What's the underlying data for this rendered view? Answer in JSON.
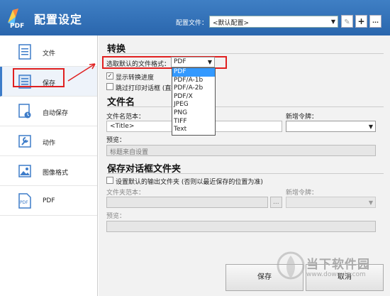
{
  "titlebar": {
    "app_title": "配置设定",
    "logo_text": "PDF",
    "config_label": "配置文件：",
    "config_value": "<默认配置>",
    "add_label": "+",
    "more_label": "···"
  },
  "sidebar": {
    "items": [
      {
        "label": "文件",
        "icon": "document-icon"
      },
      {
        "label": "保存",
        "icon": "save-icon"
      },
      {
        "label": "自动保存",
        "icon": "autosave-icon"
      },
      {
        "label": "动作",
        "icon": "wrench-icon"
      },
      {
        "label": "图像格式",
        "icon": "image-icon"
      },
      {
        "label": "PDF",
        "icon": "pdf-file-icon"
      }
    ]
  },
  "convert": {
    "title": "转换",
    "format_label": "选取默认的文件格式：",
    "format_value": "PDF",
    "show_progress_label": "显示转换进度",
    "show_progress_checked": true,
    "skip_dialog_label": "跳过打印对话框 (直接",
    "skip_dialog_checked": false,
    "options": [
      "PDF",
      "PDF/A-1b",
      "PDF/A-2b",
      "PDF/X",
      "JPEG",
      "PNG",
      "TIFF",
      "Text"
    ]
  },
  "filename": {
    "title": "文件名",
    "template_label": "文件名范本：",
    "template_value": "<Title>",
    "token_label": "新增令牌：",
    "preview_label": "预览：",
    "preview_value": "标题来自设置"
  },
  "savedialog": {
    "title": "保存对话框文件夹",
    "default_folder_label": "设置默认的输出文件夹 (否则以最近保存的位置为准)",
    "default_folder_checked": false,
    "folder_template_label": "文件夹范本：",
    "browse_label": "...",
    "token_label": "新增令牌：",
    "preview_label": "预览："
  },
  "footer": {
    "save_label": "保存",
    "cancel_label": "取消"
  },
  "watermark": {
    "text": "当下软件园",
    "url": "www.downxia.com"
  },
  "colors": {
    "titlebar": "#2f6fb8",
    "highlight": "#e02020",
    "selected_option": "#3399ff"
  }
}
